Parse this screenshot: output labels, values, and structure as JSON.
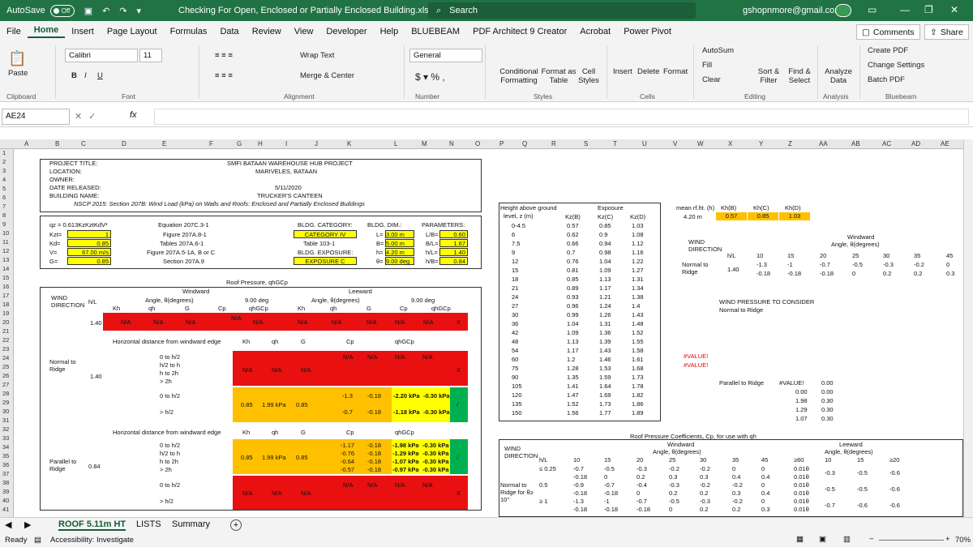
{
  "window": {
    "autosave": "AutoSave",
    "toggle": "Off",
    "doc_title": "Checking For Open, Enclosed or Partially Enclosed Building.xlsx",
    "search": "Search",
    "account": "gshopnmore@gmail.com"
  },
  "menu": [
    "File",
    "Home",
    "Insert",
    "Page Layout",
    "Formulas",
    "Data",
    "Review",
    "View",
    "Developer",
    "Help",
    "BLUEBEAM",
    "PDF Architect 9 Creator",
    "Acrobat",
    "Power Pivot"
  ],
  "actions": {
    "comments": "Comments",
    "share": "Share"
  },
  "ribbon": {
    "paste": "Paste",
    "font_name": "Calibri",
    "font_size": "11",
    "wrap": "Wrap Text",
    "merge": "Merge & Center",
    "number_format": "General",
    "cond": "Conditional Formatting",
    "format_table": "Format as Table",
    "cell_styles": "Cell Styles",
    "insert": "Insert",
    "delete": "Delete",
    "format": "Format",
    "autosum": "AutoSum",
    "fill": "Fill",
    "clear": "Clear",
    "sort": "Sort & Filter",
    "find": "Find & Select",
    "analyze": "Analyze Data",
    "create_pdf": "Create PDF",
    "change_settings": "Change Settings",
    "batch_pdf": "Batch PDF",
    "groups": [
      "Clipboard",
      "Font",
      "Alignment",
      "Number",
      "Styles",
      "Cells",
      "Editing",
      "Analysis",
      "Bluebeam"
    ]
  },
  "formula_bar": {
    "name_box": "AE24",
    "fx": "fx"
  },
  "columns": [
    "A",
    "B",
    "C",
    "D",
    "E",
    "F",
    "G",
    "H",
    "I",
    "J",
    "K",
    "L",
    "M",
    "N",
    "O",
    "P",
    "Q",
    "R",
    "S",
    "T",
    "U",
    "V",
    "W",
    "X",
    "Y",
    "Z",
    "AA",
    "AB",
    "AC",
    "AD",
    "AE"
  ],
  "project": {
    "labels": [
      "PROJECT TITLE:",
      "LOCATION:",
      "OWNER:",
      "DATE RELEASED:",
      "BUILDING NAME:"
    ],
    "title": "SMFI BATAAN WAREHOUSE HUB PROJECT",
    "location": "MARIVELES, BATAAN",
    "date": "5/11/2020",
    "building": "TRUCKER'S CANTEEN",
    "code": "NSCP 2015: Section 207B: Wind Load (kPa) on Walls and Roofs: Enclosed and Partially Enclosed Buildings"
  },
  "params": {
    "qz": "qz = 0.613KzKztKdV²",
    "kzt": "Kzt=",
    "kzt_v": "1",
    "kd": "Kd=",
    "kd_v": "0.85",
    "v": "V=",
    "v_v": "67.00 m/s",
    "g": "G=",
    "g_v": "0.85",
    "ref": [
      "Equation 207C.3-1",
      "Figure 207A.8-1",
      "Tables 207A.6-1",
      "Figure 207A.5-1A, B or C",
      "Section 207A.9"
    ],
    "bldg_cat": "BLDG. CATEGORY:",
    "cat_v": "CATEGORY IV",
    "table": "Table 103-1",
    "exposure": "BLDG. EXPOSURE:",
    "exp_v": "EXPOSURE C",
    "dim": "BLDG. DIM.:",
    "L": "L=",
    "L_v": "3.00 m",
    "B": "B=",
    "B_v": "5.00 m",
    "h": "h=",
    "h_v": "4.20 m",
    "th": "θ=",
    "th_v": "9.00 deg",
    "par": "PARAMETERS:",
    "pars": [
      "L/B=",
      "B/L=",
      "h/L=",
      "h/B="
    ],
    "pars_v": [
      "0.60",
      "1.67",
      "1.40",
      "0.84"
    ]
  },
  "roof": {
    "title": "Roof Pressure, qhGCp",
    "wind_dir": "WIND DIRECTION",
    "hl": "h/L",
    "windward": "Windward",
    "leeward": "Leeward",
    "angle": "Angle, θ(degrees)",
    "deg9": "9.00 deg",
    "kh": "Kh",
    "qh": "qh",
    "G": "G",
    "cp": "Cp",
    "qgcp": "qhGCp",
    "na": "N/A",
    "x": "X",
    "slash": "/",
    "hl_140": "1.40",
    "hl_084": "0.84",
    "normal": "Normal to Ridge",
    "parallel": "Parallel to Ridge",
    "horiz": "Horizontal distance from windward edge",
    "rows1": [
      "0 to h/2",
      "h/2 to h",
      "h to 2h",
      "> 2h"
    ],
    "rows2": [
      "0 to h/2",
      "> h/2"
    ],
    "kh_v": "0.85",
    "qh_v": "1.99 kPa",
    "g_v": "0.85",
    "cp1": [
      "-1.3",
      "-0.18"
    ],
    "q1": [
      "-2.20 kPa",
      "-0.30 kPa"
    ],
    "cp2": [
      "-0.7",
      "-0.18"
    ],
    "q2": [
      "-1.18 kPa",
      "-0.30 kPa"
    ],
    "p_cp": [
      [
        "-1.17",
        "-0.18"
      ],
      [
        "-0.76",
        "-0.18"
      ],
      [
        "-0.64",
        "-0.18"
      ],
      [
        "-0.57",
        "-0.18"
      ]
    ],
    "p_q": [
      [
        "-1.98 kPa",
        "-0.30 kPa"
      ],
      [
        "-1.29 kPa",
        "-0.30 kPa"
      ],
      [
        "-1.07 kPa",
        "-0.30 kPa"
      ],
      [
        "-0.97 kPa",
        "-0.30 kPa"
      ]
    ]
  },
  "exposure": {
    "h1": "Height above ground",
    "h2": "level, z (m)",
    "exp": "Exposure",
    "cols": [
      "Kz(B)",
      "Kz(C)",
      "Kz(D)"
    ],
    "rows": [
      [
        "0-4.5",
        "0.57",
        "0.85",
        "1.03"
      ],
      [
        "6",
        "0.62",
        "0.9",
        "1.08"
      ],
      [
        "7.5",
        "0.66",
        "0.94",
        "1.12"
      ],
      [
        "9",
        "0.7",
        "0.98",
        "1.16"
      ],
      [
        "12",
        "0.76",
        "1.04",
        "1.22"
      ],
      [
        "15",
        "0.81",
        "1.09",
        "1.27"
      ],
      [
        "18",
        "0.85",
        "1.13",
        "1.31"
      ],
      [
        "21",
        "0.89",
        "1.17",
        "1.34"
      ],
      [
        "24",
        "0.93",
        "1.21",
        "1.38"
      ],
      [
        "27",
        "0.96",
        "1.24",
        "1.4"
      ],
      [
        "30",
        "0.99",
        "1.26",
        "1.43"
      ],
      [
        "36",
        "1.04",
        "1.31",
        "1.48"
      ],
      [
        "42",
        "1.09",
        "1.36",
        "1.52"
      ],
      [
        "48",
        "1.13",
        "1.39",
        "1.55"
      ],
      [
        "54",
        "1.17",
        "1.43",
        "1.58"
      ],
      [
        "60",
        "1.2",
        "1.46",
        "1.61"
      ],
      [
        "75",
        "1.28",
        "1.53",
        "1.68"
      ],
      [
        "90",
        "1.35",
        "1.59",
        "1.73"
      ],
      [
        "105",
        "1.41",
        "1.64",
        "1.78"
      ],
      [
        "120",
        "1.47",
        "1.69",
        "1.82"
      ],
      [
        "135",
        "1.52",
        "1.73",
        "1.86"
      ],
      [
        "150",
        "1.56",
        "1.77",
        "1.89"
      ]
    ]
  },
  "mrh": {
    "label": "mean rf.ht. (h)",
    "h": "4.20 m",
    "heads": [
      "Kh(B)",
      "Kh(C)",
      "Kh(D)"
    ],
    "vals": [
      "0.57",
      "0.85",
      "1.03"
    ]
  },
  "right": {
    "wind_dir": "WIND DIRECTION",
    "windward": "Windward",
    "angle": "Angle, θ(degrees)",
    "hl": "h/L",
    "angles": [
      "10",
      "15",
      "20",
      "25",
      "30",
      "35",
      "45"
    ],
    "normal": "Normal to Ridge",
    "hl_v": "1.40",
    "row1": [
      "-1.3",
      "-1",
      "-0.7",
      "-0.5",
      "-0.3",
      "-0.2",
      "0"
    ],
    "row2": [
      "-0.18",
      "-0.18",
      "-0.18",
      "0",
      "0.2",
      "0.2",
      "0.3"
    ],
    "consider": "WIND PRESSURE TO CONSIDER",
    "consider2": "Normal to Ridge",
    "value_err": "#VALUE!",
    "parallel": "Parallel to Ridge",
    "par_vals": [
      [
        "0.00",
        "0.00"
      ],
      [
        "1.98",
        "0.30"
      ],
      [
        "1.29",
        "0.30"
      ],
      [
        "1.07",
        "0.30"
      ]
    ]
  },
  "coef": {
    "title": "Roof Pressure Coefficients, Cp, for use with qh",
    "wind_dir": "WIND DIRECTION",
    "windward": "Windward",
    "leeward": "Leeward",
    "angle": "Angle, θ(degrees)",
    "hl": "h/L",
    "cols": [
      "10",
      "15",
      "20",
      "25",
      "30",
      "35",
      "45",
      "≥60"
    ],
    "lee_cols": [
      "10",
      "15",
      "≥20"
    ],
    "normal": "Normal to Ridge for θ≥ 10°",
    "rows": [
      [
        "≤ 0.25",
        "-0.7",
        "-0.5",
        "-0.3",
        "-0.2",
        "-0.2",
        "0",
        "0",
        "0.01θ"
      ],
      [
        "",
        "-0.18",
        "0",
        "0.2",
        "0.3",
        "0.3",
        "0.4",
        "0.4",
        "0.01θ"
      ],
      [
        "0.5",
        "-0.9",
        "-0.7",
        "-0.4",
        "-0.3",
        "-0.2",
        "-0.2",
        "0",
        "0.01θ"
      ],
      [
        "",
        "-0.18",
        "-0.18",
        "0",
        "0.2",
        "0.2",
        "0.3",
        "0.4",
        "0.01θ"
      ],
      [
        "≥ 1",
        "-1.3",
        "-1",
        "-0.7",
        "-0.5",
        "-0.3",
        "-0.2",
        "0",
        "0.01θ"
      ],
      [
        "",
        "-0.18",
        "-0.18",
        "-0.18",
        "0",
        "0.2",
        "0.2",
        "0.3",
        "0.01θ"
      ]
    ],
    "lee": [
      [
        "-0.3",
        "-0.5",
        "-0.6"
      ],
      [
        "-0.5",
        "-0.5",
        "-0.6"
      ],
      [
        "-0.7",
        "-0.6",
        "-0.6"
      ]
    ]
  },
  "tabs": [
    "ROOF 5.11m HT",
    "LISTS",
    "Summary"
  ],
  "status": {
    "ready": "Ready",
    "access": "Accessibility: Investigate",
    "zoom": "70%"
  }
}
